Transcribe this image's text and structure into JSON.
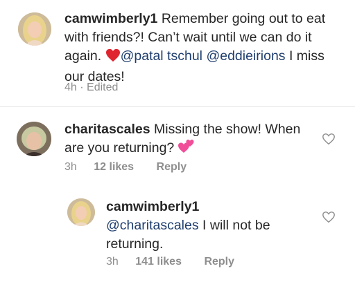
{
  "comments": [
    {
      "username": "camwimberly1",
      "text_before": "Remember going out to eat with friends?! Can’t wait until we can do it again.",
      "emoji_heart": "❤️",
      "mention1": "@patal tschul",
      "mention2": "@eddieirions",
      "text_after": "I miss our dates!",
      "time": "4h",
      "separator": "·",
      "edited": "Edited"
    },
    {
      "username": "charitascales",
      "text": "Missing the show! When are you returning?",
      "emoji": "💕",
      "time": "3h",
      "likes": "12 likes",
      "reply": "Reply"
    },
    {
      "username": "camwimberly1",
      "mention": "@charitascales",
      "text": "I will not be returning.",
      "time": "3h",
      "likes": "141 likes",
      "reply": "Reply"
    }
  ],
  "colors": {
    "mention": "#1f3e6e",
    "meta": "#8e8e8e",
    "heart_red": "#e0242f",
    "heart_pink": "#f04e98"
  },
  "icons": [
    "heart-outline-icon",
    "heart-emoji-icon",
    "two-hearts-emoji-icon"
  ]
}
